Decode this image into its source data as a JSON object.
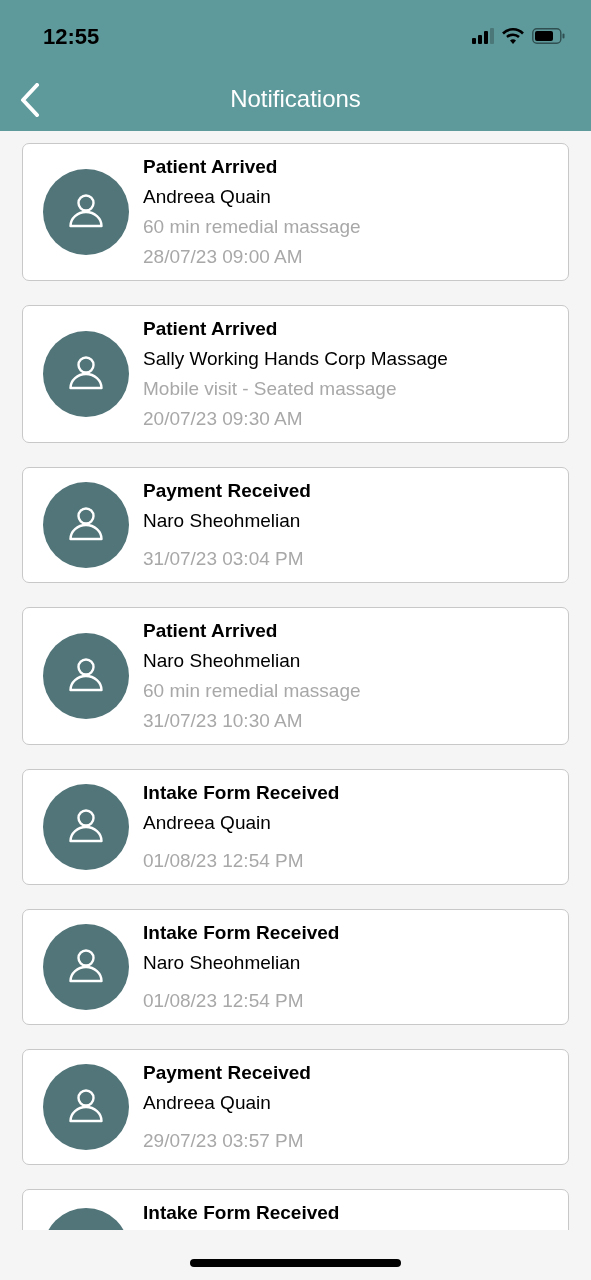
{
  "status_bar": {
    "time": "12:55"
  },
  "header": {
    "title": "Notifications"
  },
  "notifications": [
    {
      "title": "Patient Arrived",
      "name": "Andreea Quain",
      "detail": "60 min remedial massage",
      "time": "28/07/23 09:00 AM"
    },
    {
      "title": "Patient Arrived",
      "name": "Sally Working Hands Corp Massage",
      "detail": "Mobile visit - Seated massage",
      "time": "20/07/23 09:30 AM"
    },
    {
      "title": "Payment Received",
      "name": "Naro Sheohmelian",
      "time": "31/07/23 03:04 PM"
    },
    {
      "title": "Patient Arrived",
      "name": "Naro Sheohmelian",
      "detail": "60 min remedial massage",
      "time": "31/07/23 10:30 AM"
    },
    {
      "title": "Intake Form Received",
      "name": "Andreea Quain",
      "time": "01/08/23 12:54 PM"
    },
    {
      "title": "Intake Form Received",
      "name": "Naro Sheohmelian",
      "time": "01/08/23 12:54 PM"
    },
    {
      "title": "Payment Received",
      "name": "Andreea Quain",
      "time": "29/07/23 03:57 PM"
    },
    {
      "title": "Intake Form Received"
    }
  ]
}
